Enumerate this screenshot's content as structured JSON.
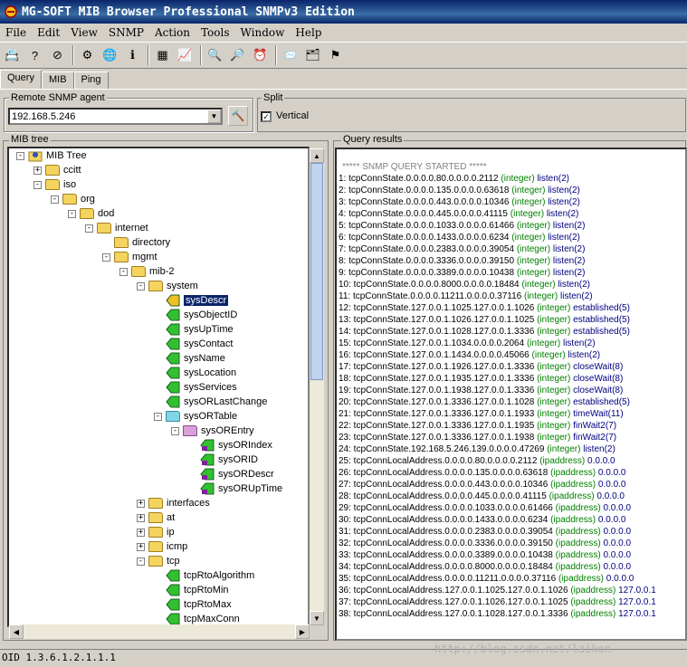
{
  "window": {
    "title": "MG-SOFT MIB Browser Professional SNMPv3 Edition"
  },
  "menu": [
    "File",
    "Edit",
    "View",
    "SNMP",
    "Action",
    "Tools",
    "Window",
    "Help"
  ],
  "toolbar": [
    "contact-icon",
    "help-icon",
    "stop-icon",
    "tools-icon",
    "globe-icon",
    "info-icon",
    "table-icon",
    "graph-icon",
    "search-icon",
    "find-icon",
    "alarm-icon",
    "trap-icon",
    "compile-icon",
    "flag-icon"
  ],
  "tabs": [
    "Query",
    "MIB",
    "Ping"
  ],
  "agent": {
    "label": "Remote SNMP agent",
    "value": "192.168.5.246"
  },
  "split": {
    "label": "Split",
    "vertical_label": "Vertical",
    "checked": true
  },
  "tree": {
    "label": "MIB tree",
    "nodes": [
      {
        "label": "MIB Tree",
        "level": 0,
        "exp": "-",
        "icon": "root"
      },
      {
        "label": "ccitt",
        "level": 1,
        "exp": "+",
        "icon": "folder"
      },
      {
        "label": "iso",
        "level": 1,
        "exp": "-",
        "icon": "folder"
      },
      {
        "label": "org",
        "level": 2,
        "exp": "-",
        "icon": "folder"
      },
      {
        "label": "dod",
        "level": 3,
        "exp": "-",
        "icon": "folder"
      },
      {
        "label": "internet",
        "level": 4,
        "exp": "-",
        "icon": "folder"
      },
      {
        "label": "directory",
        "level": 5,
        "exp": "",
        "icon": "folder"
      },
      {
        "label": "mgmt",
        "level": 5,
        "exp": "-",
        "icon": "folder"
      },
      {
        "label": "mib-2",
        "level": 6,
        "exp": "-",
        "icon": "folder"
      },
      {
        "label": "system",
        "level": 7,
        "exp": "-",
        "icon": "folder"
      },
      {
        "label": "sysDescr",
        "level": 8,
        "exp": "",
        "icon": "leaf-selected",
        "selected": true
      },
      {
        "label": "sysObjectID",
        "level": 8,
        "exp": "",
        "icon": "leaf"
      },
      {
        "label": "sysUpTime",
        "level": 8,
        "exp": "",
        "icon": "leaf"
      },
      {
        "label": "sysContact",
        "level": 8,
        "exp": "",
        "icon": "leaf"
      },
      {
        "label": "sysName",
        "level": 8,
        "exp": "",
        "icon": "leaf"
      },
      {
        "label": "sysLocation",
        "level": 8,
        "exp": "",
        "icon": "leaf"
      },
      {
        "label": "sysServices",
        "level": 8,
        "exp": "",
        "icon": "leaf"
      },
      {
        "label": "sysORLastChange",
        "level": 8,
        "exp": "",
        "icon": "leaf"
      },
      {
        "label": "sysORTable",
        "level": 8,
        "exp": "-",
        "icon": "table"
      },
      {
        "label": "sysOREntry",
        "level": 9,
        "exp": "-",
        "icon": "entry"
      },
      {
        "label": "sysORIndex",
        "level": 10,
        "exp": "",
        "icon": "leaf-col"
      },
      {
        "label": "sysORID",
        "level": 10,
        "exp": "",
        "icon": "leaf-col"
      },
      {
        "label": "sysORDescr",
        "level": 10,
        "exp": "",
        "icon": "leaf-col"
      },
      {
        "label": "sysORUpTime",
        "level": 10,
        "exp": "",
        "icon": "leaf-col"
      },
      {
        "label": "interfaces",
        "level": 7,
        "exp": "+",
        "icon": "folder"
      },
      {
        "label": "at",
        "level": 7,
        "exp": "+",
        "icon": "folder"
      },
      {
        "label": "ip",
        "level": 7,
        "exp": "+",
        "icon": "folder"
      },
      {
        "label": "icmp",
        "level": 7,
        "exp": "+",
        "icon": "folder"
      },
      {
        "label": "tcp",
        "level": 7,
        "exp": "-",
        "icon": "folder"
      },
      {
        "label": "tcpRtoAlgorithm",
        "level": 8,
        "exp": "",
        "icon": "leaf"
      },
      {
        "label": "tcpRtoMin",
        "level": 8,
        "exp": "",
        "icon": "leaf"
      },
      {
        "label": "tcpRtoMax",
        "level": 8,
        "exp": "",
        "icon": "leaf"
      },
      {
        "label": "tcpMaxConn",
        "level": 8,
        "exp": "",
        "icon": "leaf"
      }
    ]
  },
  "results": {
    "label": "Query results",
    "header": "***** SNMP QUERY STARTED *****",
    "lines": [
      [
        "1: tcpConnState.0.0.0.0.80.0.0.0.0.2112",
        "(integer)",
        "listen(2)"
      ],
      [
        "2: tcpConnState.0.0.0.0.135.0.0.0.0.63618",
        "(integer)",
        "listen(2)"
      ],
      [
        "3: tcpConnState.0.0.0.0.443.0.0.0.0.10346",
        "(integer)",
        "listen(2)"
      ],
      [
        "4: tcpConnState.0.0.0.0.445.0.0.0.0.41115",
        "(integer)",
        "listen(2)"
      ],
      [
        "5: tcpConnState.0.0.0.0.1033.0.0.0.0.61466",
        "(integer)",
        "listen(2)"
      ],
      [
        "6: tcpConnState.0.0.0.0.1433.0.0.0.0.6234",
        "(integer)",
        "listen(2)"
      ],
      [
        "7: tcpConnState.0.0.0.0.2383.0.0.0.0.39054",
        "(integer)",
        "listen(2)"
      ],
      [
        "8: tcpConnState.0.0.0.0.3336.0.0.0.0.39150",
        "(integer)",
        "listen(2)"
      ],
      [
        "9: tcpConnState.0.0.0.0.3389.0.0.0.0.10438",
        "(integer)",
        "listen(2)"
      ],
      [
        "10: tcpConnState.0.0.0.0.8000.0.0.0.0.18484",
        "(integer)",
        "listen(2)"
      ],
      [
        "11: tcpConnState.0.0.0.0.11211.0.0.0.0.37116",
        "(integer)",
        "listen(2)"
      ],
      [
        "12: tcpConnState.127.0.0.1.1025.127.0.0.1.1026",
        "(integer)",
        "established(5)"
      ],
      [
        "13: tcpConnState.127.0.0.1.1026.127.0.0.1.1025",
        "(integer)",
        "established(5)"
      ],
      [
        "14: tcpConnState.127.0.0.1.1028.127.0.0.1.3336",
        "(integer)",
        "established(5)"
      ],
      [
        "15: tcpConnState.127.0.0.1.1034.0.0.0.0.2064",
        "(integer)",
        "listen(2)"
      ],
      [
        "16: tcpConnState.127.0.0.1.1434.0.0.0.0.45066",
        "(integer)",
        "listen(2)"
      ],
      [
        "17: tcpConnState.127.0.0.1.1926.127.0.0.1.3336",
        "(integer)",
        "closeWait(8)"
      ],
      [
        "18: tcpConnState.127.0.0.1.1935.127.0.0.1.3336",
        "(integer)",
        "closeWait(8)"
      ],
      [
        "19: tcpConnState.127.0.0.1.1938.127.0.0.1.3336",
        "(integer)",
        "closeWait(8)"
      ],
      [
        "20: tcpConnState.127.0.0.1.3336.127.0.0.1.1028",
        "(integer)",
        "established(5)"
      ],
      [
        "21: tcpConnState.127.0.0.1.3336.127.0.0.1.1933",
        "(integer)",
        "timeWait(11)"
      ],
      [
        "22: tcpConnState.127.0.0.1.3336.127.0.0.1.1935",
        "(integer)",
        "finWait2(7)"
      ],
      [
        "23: tcpConnState.127.0.0.1.3336.127.0.0.1.1938",
        "(integer)",
        "finWait2(7)"
      ],
      [
        "24: tcpConnState.192.168.5.246.139.0.0.0.0.47269",
        "(integer)",
        "listen(2)"
      ],
      [
        "25: tcpConnLocalAddress.0.0.0.0.80.0.0.0.0.2112",
        "(ipaddress)",
        "0.0.0.0"
      ],
      [
        "26: tcpConnLocalAddress.0.0.0.0.135.0.0.0.0.63618",
        "(ipaddress)",
        "0.0.0.0"
      ],
      [
        "27: tcpConnLocalAddress.0.0.0.0.443.0.0.0.0.10346",
        "(ipaddress)",
        "0.0.0.0"
      ],
      [
        "28: tcpConnLocalAddress.0.0.0.0.445.0.0.0.0.41115",
        "(ipaddress)",
        "0.0.0.0"
      ],
      [
        "29: tcpConnLocalAddress.0.0.0.0.1033.0.0.0.0.61466",
        "(ipaddress)",
        "0.0.0.0"
      ],
      [
        "30: tcpConnLocalAddress.0.0.0.0.1433.0.0.0.0.6234",
        "(ipaddress)",
        "0.0.0.0"
      ],
      [
        "31: tcpConnLocalAddress.0.0.0.0.2383.0.0.0.0.39054",
        "(ipaddress)",
        "0.0.0.0"
      ],
      [
        "32: tcpConnLocalAddress.0.0.0.0.3336.0.0.0.0.39150",
        "(ipaddress)",
        "0.0.0.0"
      ],
      [
        "33: tcpConnLocalAddress.0.0.0.0.3389.0.0.0.0.10438",
        "(ipaddress)",
        "0.0.0.0"
      ],
      [
        "34: tcpConnLocalAddress.0.0.0.0.8000.0.0.0.0.18484",
        "(ipaddress)",
        "0.0.0.0"
      ],
      [
        "35: tcpConnLocalAddress.0.0.0.0.11211.0.0.0.0.37116",
        "(ipaddress)",
        "0.0.0.0"
      ],
      [
        "36: tcpConnLocalAddress.127.0.0.1.1025.127.0.0.1.1026",
        "(ipaddress)",
        "127.0.0.1"
      ],
      [
        "37: tcpConnLocalAddress.127.0.0.1.1026.127.0.0.1.1025",
        "(ipaddress)",
        "127.0.0.1"
      ],
      [
        "38: tcpConnLocalAddress.127.0.0.1.1028.127.0.0.1.3336",
        "(ipaddress)",
        "127.0.0.1"
      ]
    ]
  },
  "status": {
    "oid": "OID 1.3.6.1.2.1.1.1"
  },
  "watermark": "http://blog.csdn.net/laikon"
}
